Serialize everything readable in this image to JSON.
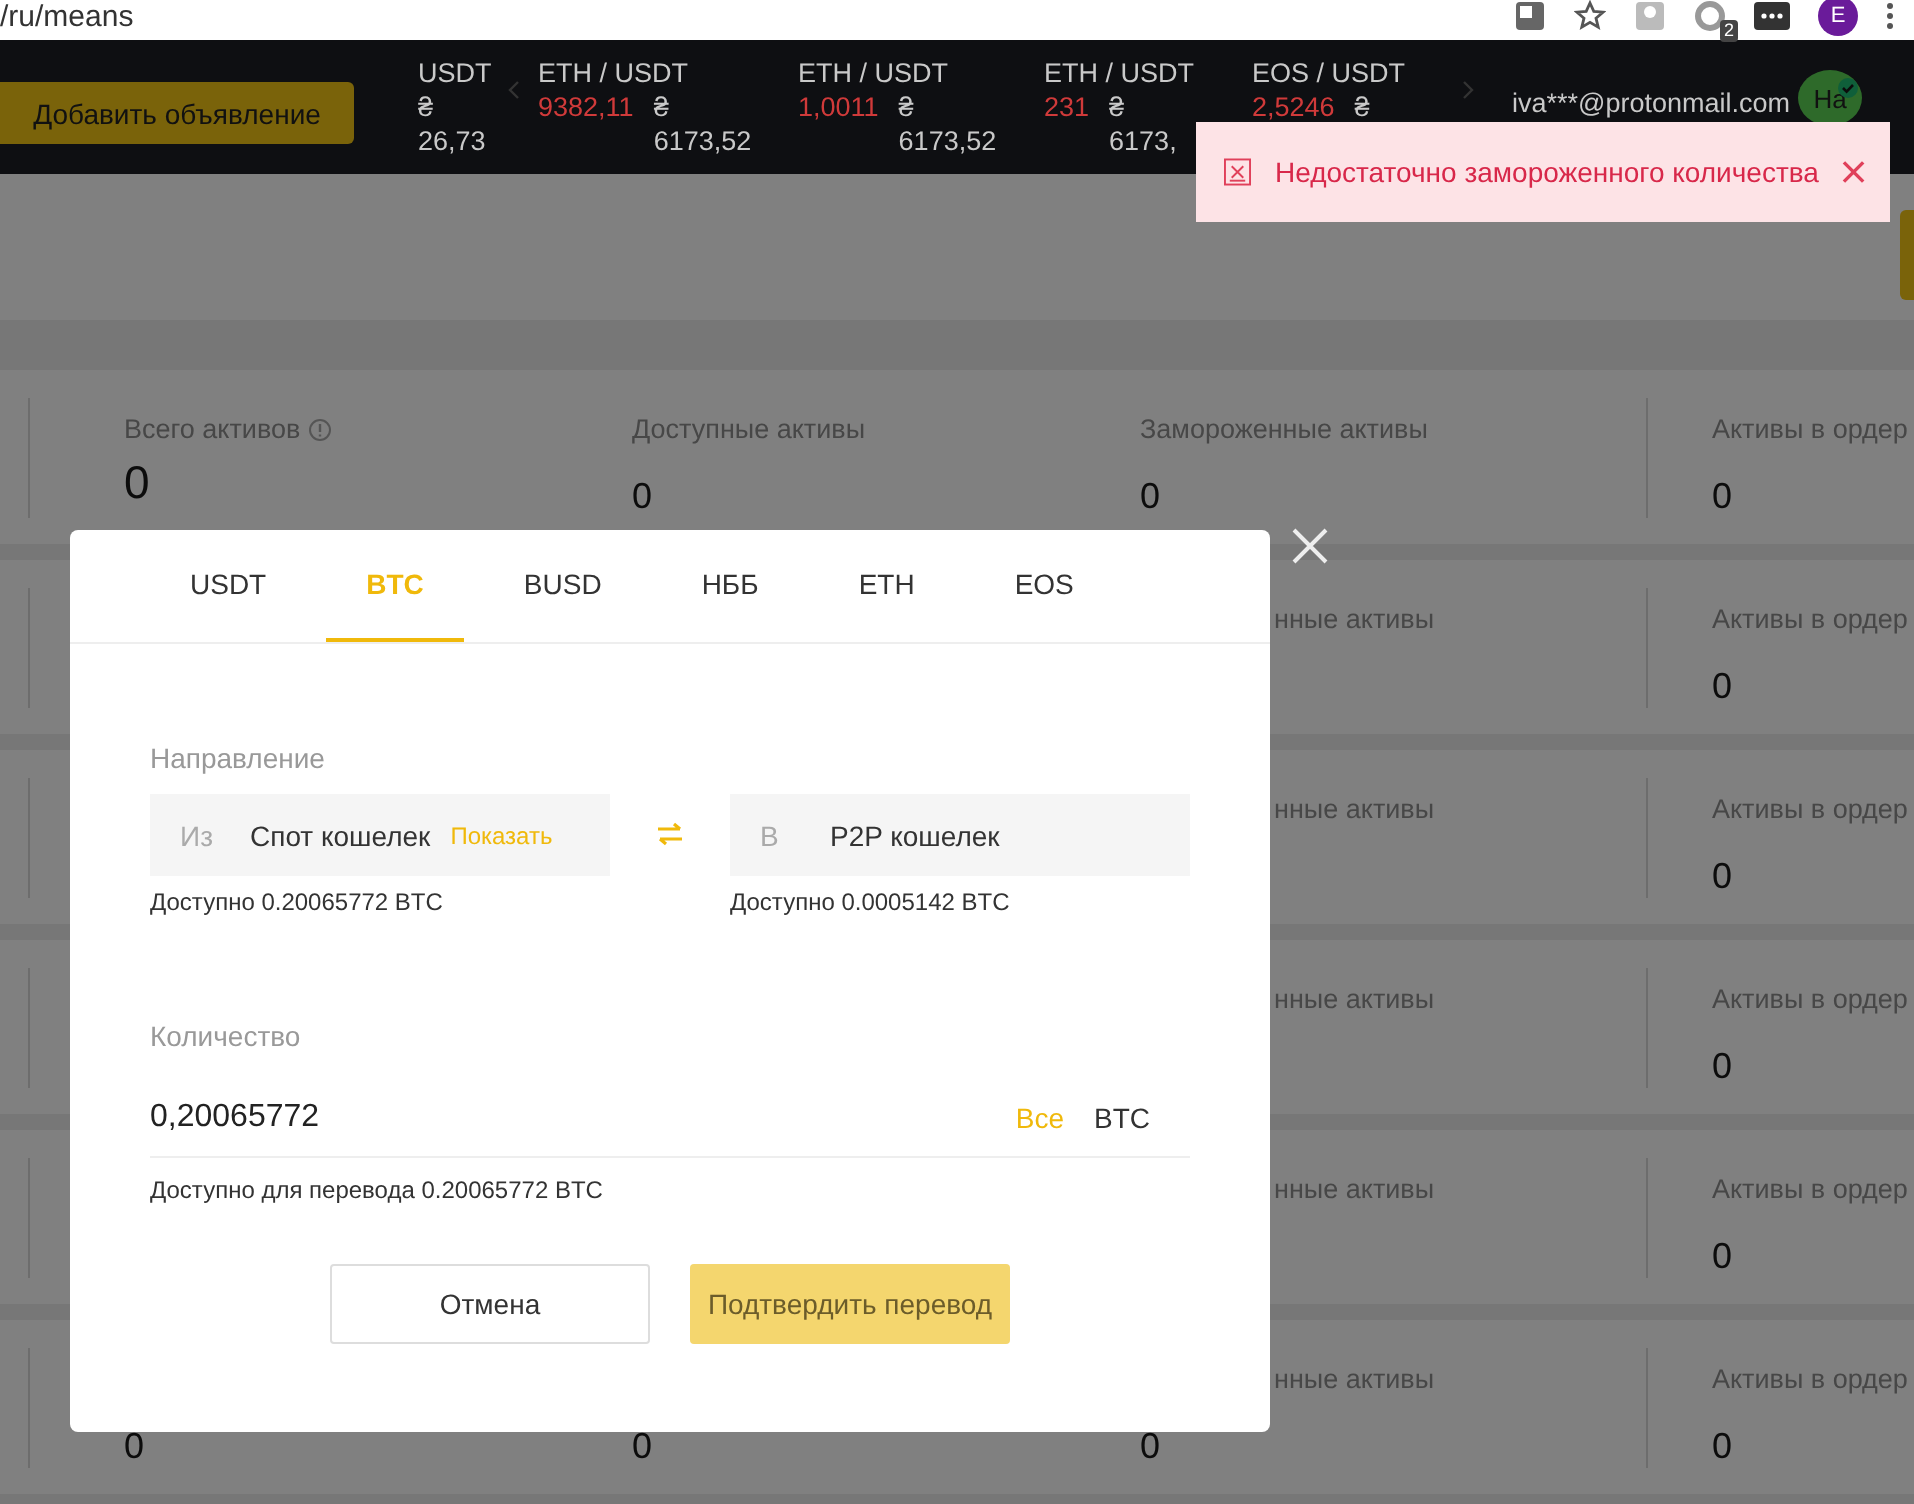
{
  "browser": {
    "url": "/ru/means",
    "extension_badge": "2",
    "profile_initial": "E"
  },
  "nav": {
    "add_button": "Добавить объявление",
    "tickers": [
      {
        "pair": "USDT",
        "fiat_symbol": "₴",
        "fiat_value": "26,73"
      },
      {
        "pair": "ETH / USDT",
        "price": "9382,11",
        "fiat_symbol": "₴",
        "fiat_value": "6173,52"
      },
      {
        "pair": "ETH / USDT",
        "price": "1,0011",
        "fiat_symbol": "₴",
        "fiat_value": "6173,52"
      },
      {
        "pair": "ETH / USDT",
        "price": "231",
        "fiat_symbol": "₴",
        "fiat_value": "6173,"
      },
      {
        "pair": "EOS / USDT",
        "price": "2,5246",
        "fiat_symbol": "₴"
      }
    ],
    "email": "iva***@protonmail.com",
    "avatar": "Ha"
  },
  "toast": {
    "message": "Недостаточно замороженного количества"
  },
  "asset_rows": [
    {
      "total": {
        "label": "Всего активов",
        "value": "0"
      },
      "available": {
        "label": "Доступные активы",
        "value": "0"
      },
      "frozen": {
        "label": "Замороженные активы",
        "value": "0"
      },
      "in_orders": {
        "label": "Активы в ордер",
        "value": "0"
      }
    },
    {
      "frozen": {
        "label": "нные активы"
      },
      "in_orders": {
        "label": "Активы в ордер",
        "value": "0"
      }
    },
    {
      "frozen": {
        "label": "нные активы"
      },
      "in_orders": {
        "label": "Активы в ордер",
        "value": "0"
      }
    },
    {
      "frozen": {
        "label": "нные активы"
      },
      "in_orders": {
        "label": "Активы в ордер",
        "value": "0"
      }
    },
    {
      "frozen": {
        "label": "нные активы"
      },
      "in_orders": {
        "label": "Активы в ордер",
        "value": "0"
      }
    },
    {
      "total": {
        "value": "0"
      },
      "available": {
        "value": "0"
      },
      "frozen": {
        "label": "нные активы",
        "value": "0"
      },
      "in_orders": {
        "label": "Активы в ордер",
        "value": "0"
      }
    }
  ],
  "modal": {
    "tabs": [
      {
        "label": "USDT",
        "selected": false
      },
      {
        "label": "BTC",
        "selected": true
      },
      {
        "label": "BUSD",
        "selected": false
      },
      {
        "label": "НББ",
        "selected": false
      },
      {
        "label": "ETH",
        "selected": false
      },
      {
        "label": "EOS",
        "selected": false
      }
    ],
    "direction_label": "Направление",
    "from": {
      "prefix": "Из",
      "wallet": "Спот кошелек",
      "link": "Показать",
      "available": "Доступно 0.20065772 BTC"
    },
    "to": {
      "prefix": "В",
      "wallet": "P2P кошелек",
      "available": "Доступно 0.0005142 BTC"
    },
    "amount_label": "Количество",
    "amount": {
      "value": "0,20065772",
      "all_link": "Все",
      "currency": "BTC"
    },
    "transfer_available": "Доступно для перевода 0.20065772 BTC",
    "buttons": [
      {
        "label": "Отмена",
        "kind": "secondary"
      },
      {
        "label": "Подтвердить перевод",
        "kind": "primary"
      }
    ]
  }
}
